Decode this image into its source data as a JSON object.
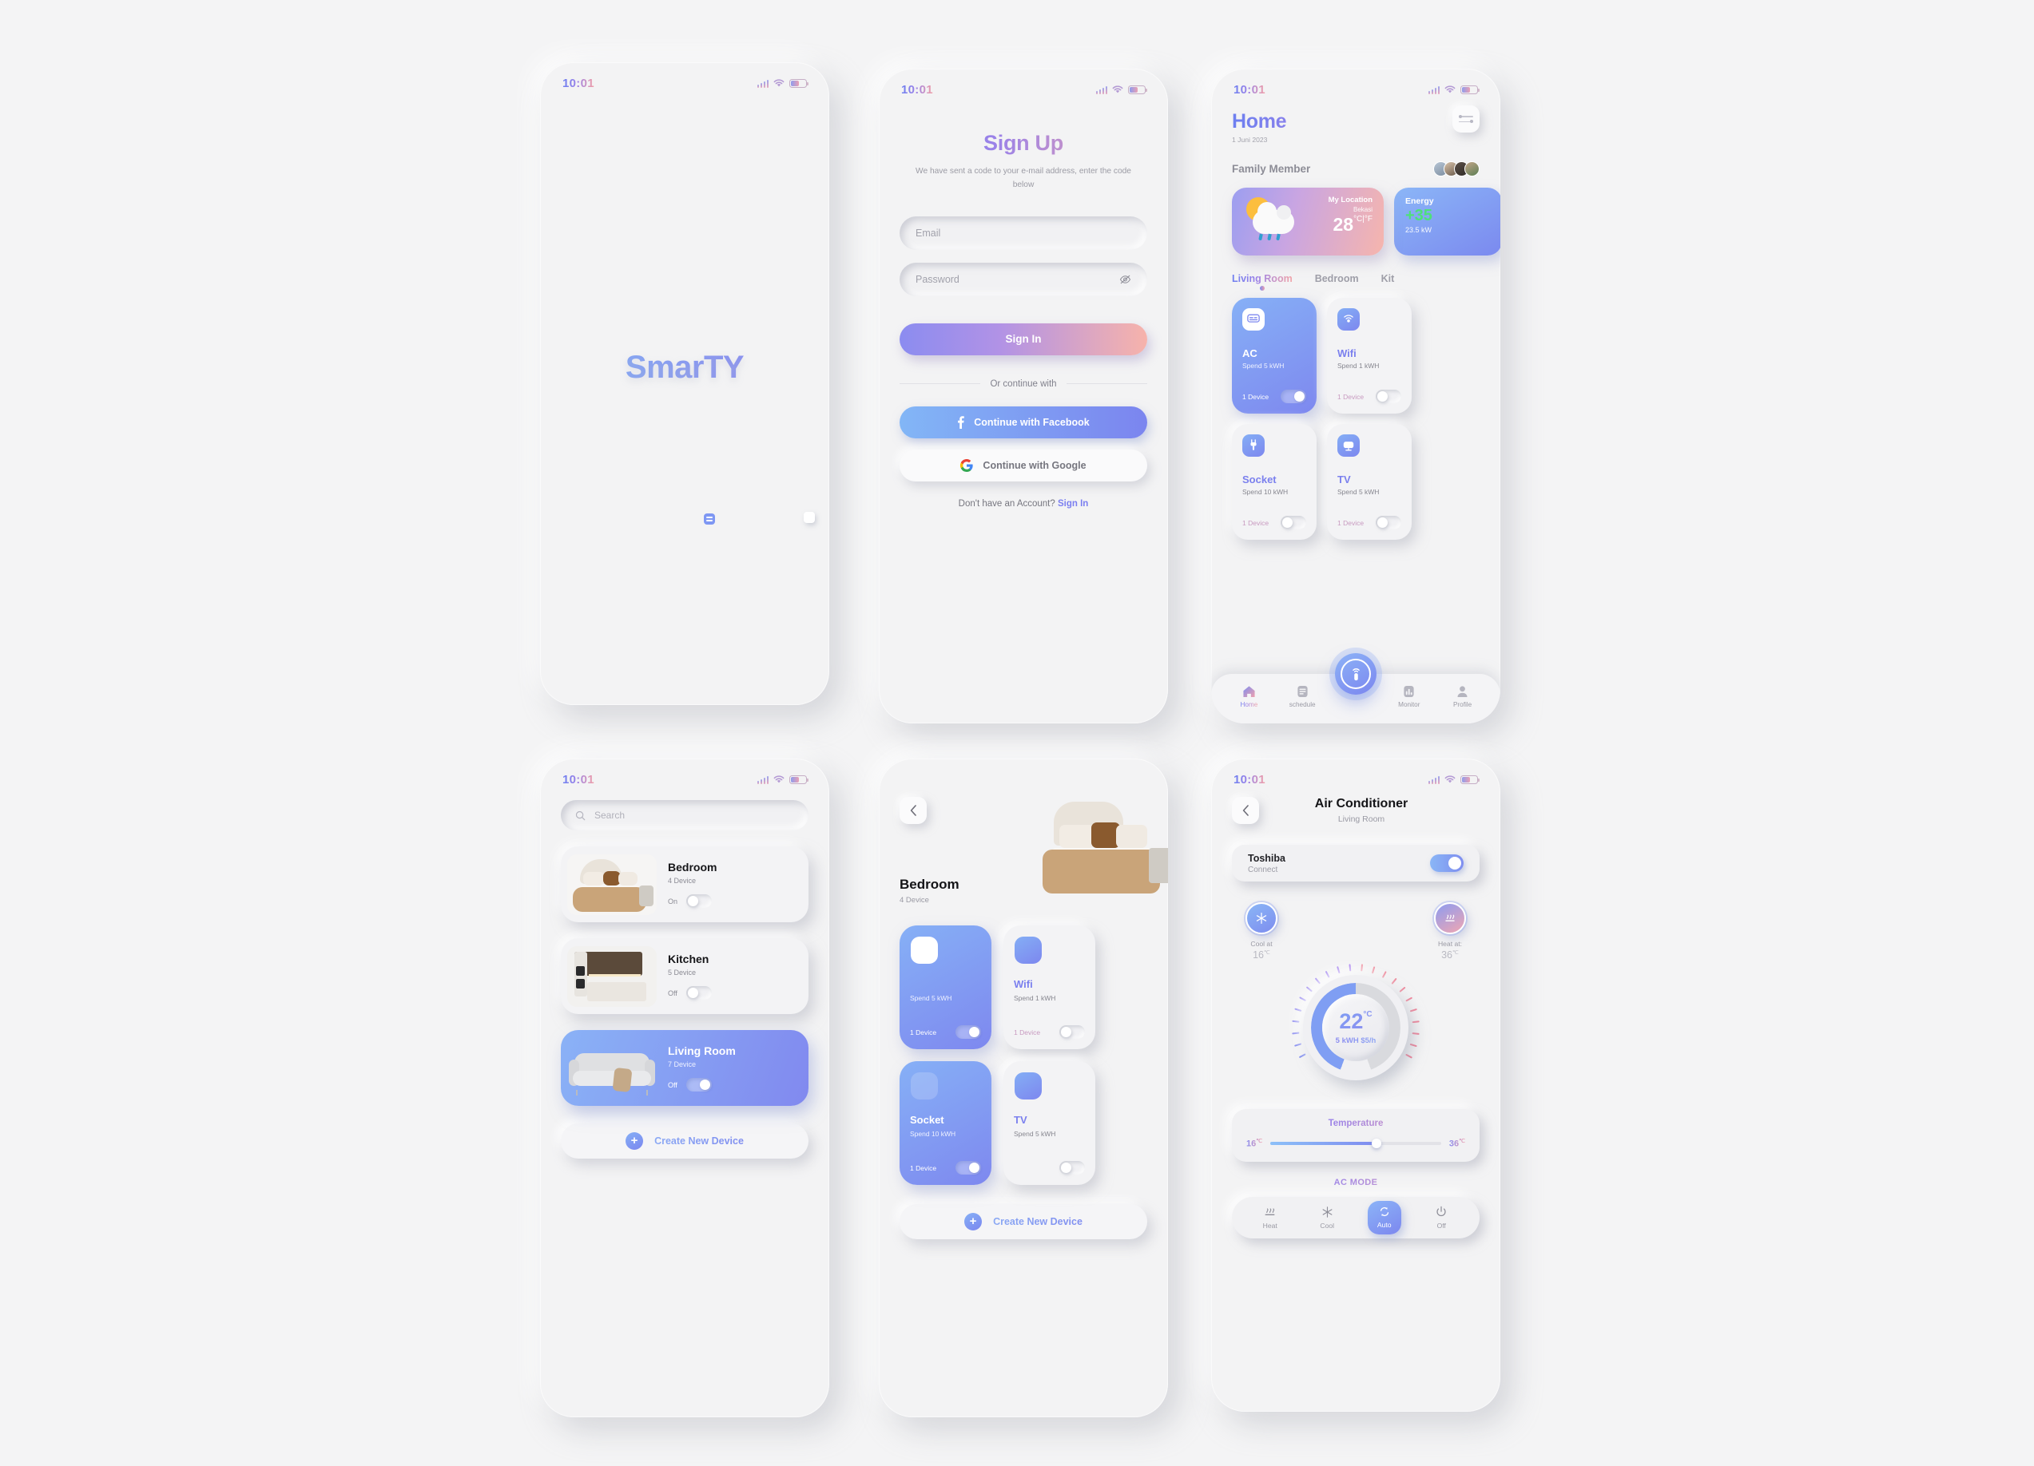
{
  "status_bar": {
    "time": "10:01"
  },
  "splash": {
    "logo": "SmarTY"
  },
  "signup": {
    "title_part1": "Sign ",
    "title_part2": "Up",
    "title": "Sign Up",
    "subtitle": "We have sent a code to your e-mail address, enter the code below",
    "email_placeholder": "Email",
    "password_placeholder": "Password",
    "signin_button": "Sign In",
    "divider": "Or  continue with",
    "facebook_button": "Continue with Facebook",
    "google_button": "Continue with Google",
    "account_prompt": "Don't have an Account?",
    "account_link": "Sign In"
  },
  "home": {
    "title": "Home",
    "date": "1 Juni 2023",
    "family_label": "Family Member",
    "weather": {
      "location_label": "My Location",
      "city": "Bekasi",
      "temperature": "28",
      "unit": "°C|°F"
    },
    "energy": {
      "label": "Energy",
      "value": "+35",
      "sub": "23.5 kW"
    },
    "tabs": [
      {
        "label": "Living Room",
        "active": true
      },
      {
        "label": "Bedroom",
        "active": false
      },
      {
        "label": "Kit",
        "active": false
      }
    ],
    "devices": [
      {
        "name": "AC",
        "spend": "Spend 5 kWH",
        "count": "1 Device",
        "state": "on"
      },
      {
        "name": "Wifi",
        "spend": "Spend 1 kWH",
        "count": "1 Device",
        "state": "off"
      },
      {
        "name": "Socket",
        "spend": "Spend 10 kWH",
        "count": "1 Device",
        "state": "off"
      },
      {
        "name": "TV",
        "spend": "Spend 5 kWH",
        "count": "1 Device",
        "state": "off"
      }
    ],
    "nav": [
      {
        "label": "Home",
        "icon": "home-icon",
        "active": true
      },
      {
        "label": "schedule",
        "icon": "schedule-icon",
        "active": false
      },
      {
        "label": "Monitor",
        "icon": "monitor-icon",
        "active": false
      },
      {
        "label": "Profile",
        "icon": "profile-icon",
        "active": false
      }
    ]
  },
  "rooms_screen": {
    "search_placeholder": "Search",
    "rooms": [
      {
        "name": "Bedroom",
        "devices": "4 Device",
        "state_label": "On",
        "toggle": "off",
        "highlighted": false
      },
      {
        "name": "Kitchen",
        "devices": "5 Device",
        "state_label": "Off",
        "toggle": "off",
        "highlighted": false
      },
      {
        "name": "Living Room",
        "devices": "7 Device",
        "state_label": "Off",
        "toggle": "on",
        "highlighted": true
      }
    ],
    "create_button": "Create New Device"
  },
  "bedroom_screen": {
    "title": "Bedroom",
    "devices_count": "4 Device",
    "devices": [
      {
        "name": "",
        "spend": "Spend 5 kWH",
        "count": "1 Device",
        "state": "on"
      },
      {
        "name": "Wifi",
        "spend": "Spend 1 kWH",
        "count": "1 Device",
        "state": "off"
      },
      {
        "name": "Socket",
        "spend": "Spend 10 kWH",
        "count": "1 Device",
        "state": "on"
      },
      {
        "name": "TV",
        "spend": "Spend 5 kWH",
        "count": "",
        "state": "off"
      }
    ],
    "create_button": "Create New Device"
  },
  "ac_screen": {
    "title": "Air Conditioner",
    "room": "Living Room",
    "brand": "Toshiba",
    "brand_status": "Connect",
    "cool": {
      "label": "Cool at",
      "value": "16",
      "unit": "℃"
    },
    "heat": {
      "label": "Heat at:",
      "value": "36",
      "unit": "℃"
    },
    "dial": {
      "temperature": "22",
      "unit": "°C",
      "cost": "5 kWH $5/h"
    },
    "temperature_card": {
      "label": "Temperature",
      "min": "16",
      "min_unit": "℃",
      "max": "36",
      "max_unit": "℃"
    },
    "mode_label": "AC MODE",
    "modes": [
      {
        "label": "Heat",
        "icon": "heat-icon",
        "active": false
      },
      {
        "label": "Cool",
        "icon": "snowflake-icon",
        "active": false
      },
      {
        "label": "Auto",
        "icon": "auto-icon",
        "active": true
      },
      {
        "label": "Off",
        "icon": "power-icon",
        "active": false
      }
    ]
  },
  "colors": {
    "accent_blue": "#7b86ee",
    "accent_pink": "#f2a4a7",
    "green": "#4ee07a",
    "background": "#f4f4f5"
  }
}
